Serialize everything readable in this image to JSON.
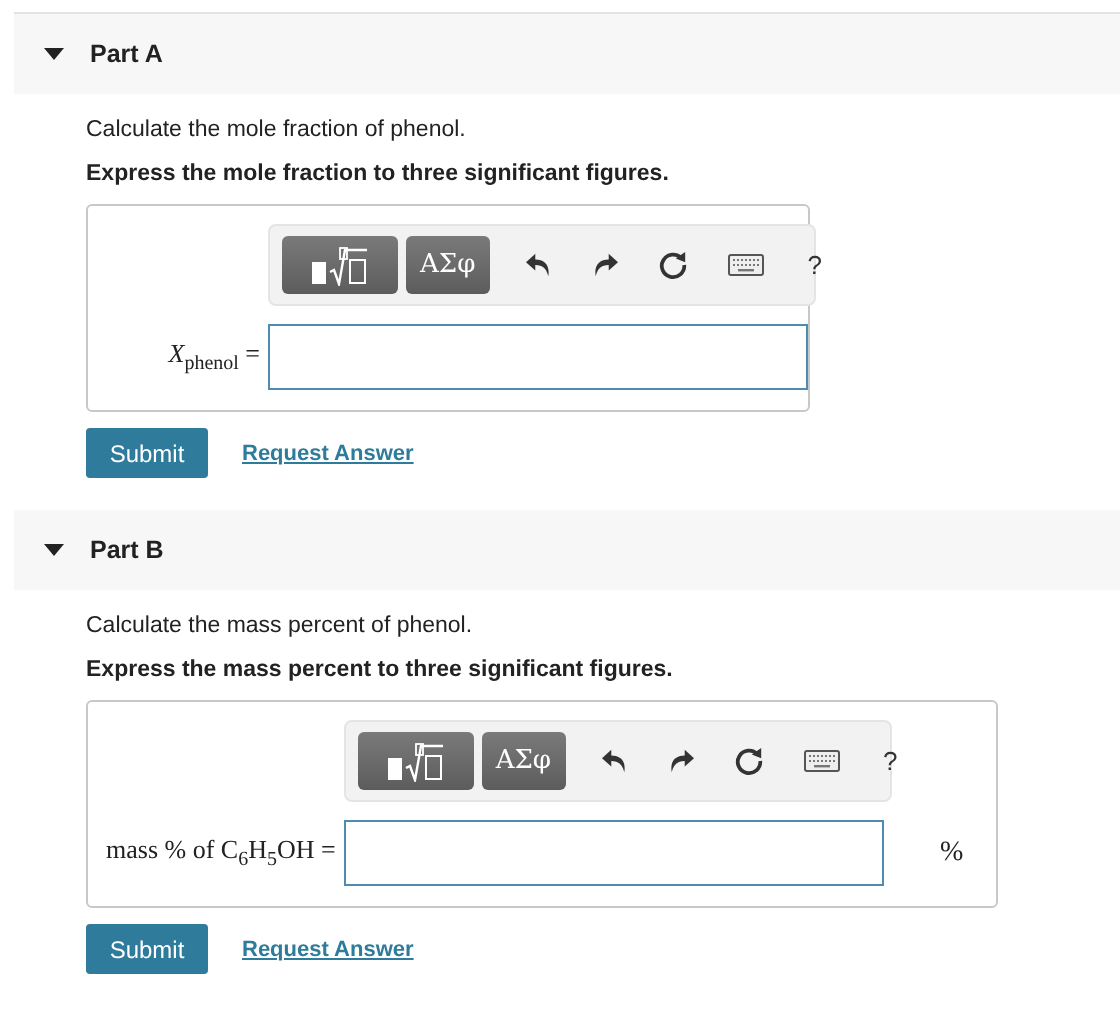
{
  "parts": [
    {
      "title": "Part A",
      "expanded": true,
      "prompt": "Calculate the mole fraction of phenol.",
      "instruction": "Express the mole fraction to three significant figures.",
      "toolbar": {
        "symbols": "ΑΣφ",
        "help": "?"
      },
      "answer": {
        "label": "*X*$_{phenol}$ ="
      },
      "buttons": {
        "submit": "Submit",
        "request": "Request Answer"
      }
    },
    {
      "title": "Part B",
      "expanded": true,
      "prompt": "Calculate the mass percent of phenol.",
      "instruction": "Express the mass percent to three significant figures.",
      "toolbar": {
        "symbols": "ΑΣφ",
        "help": "?"
      },
      "answer": {
        "label": "mass % of C$_{6}$H$_{5}$OH =",
        "unit": "%"
      },
      "buttons": {
        "submit": "Submit",
        "request": "Request Answer"
      }
    }
  ]
}
